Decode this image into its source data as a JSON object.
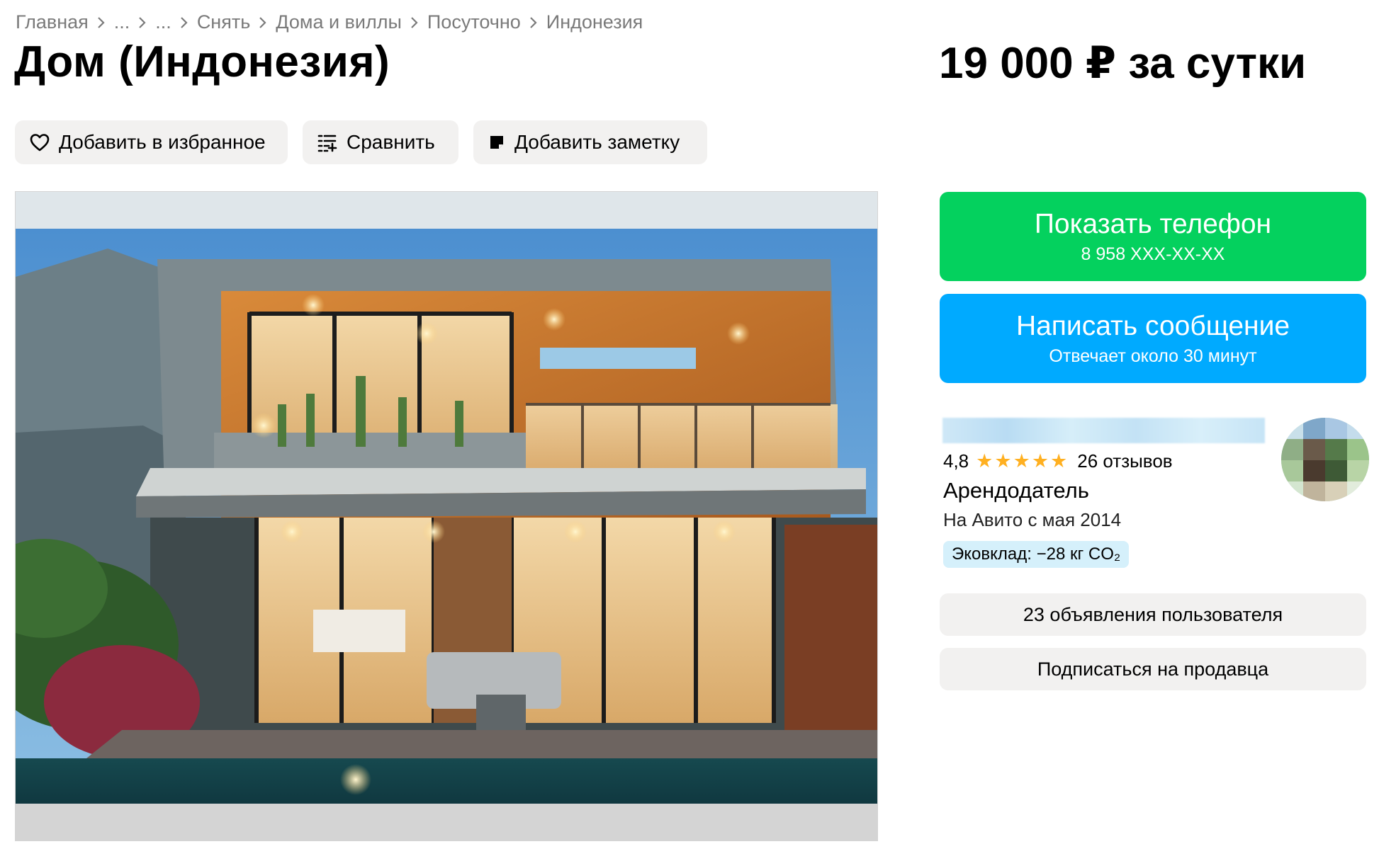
{
  "breadcrumbs": [
    {
      "label": "Главная"
    },
    {
      "label": "..."
    },
    {
      "label": "..."
    },
    {
      "label": "Снять"
    },
    {
      "label": "Дома и виллы"
    },
    {
      "label": "Посуточно"
    },
    {
      "label": "Индонезия"
    }
  ],
  "listing": {
    "title": "Дом (Индонезия)",
    "price": "19 000 ₽ за сутки"
  },
  "actions": {
    "favorite": {
      "label": "Добавить в избранное",
      "icon": "heart-icon"
    },
    "compare": {
      "label": "Сравнить",
      "icon": "compare-icon"
    },
    "note": {
      "label": "Добавить заметку",
      "icon": "note-icon"
    }
  },
  "contact": {
    "phone_label": "Показать телефон",
    "phone_masked": "8 958 XXX-XX-XX",
    "message_label": "Написать сообщение",
    "response_time": "Отвечает около 30 минут"
  },
  "seller": {
    "rating": "4,8",
    "stars": 5,
    "reviews": "26 отзывов",
    "role": "Арендодатель",
    "since": "На Авито с мая 2014",
    "eco": "Эковклад: −28 кг CO₂",
    "listings_label": "23 объявления пользователя",
    "subscribe_label": "Подписаться на продавца"
  },
  "colors": {
    "phone_button": "#04d15e",
    "message_button": "#00aaff",
    "star": "#ffb021",
    "secondary_button": "#f2f1f0"
  }
}
